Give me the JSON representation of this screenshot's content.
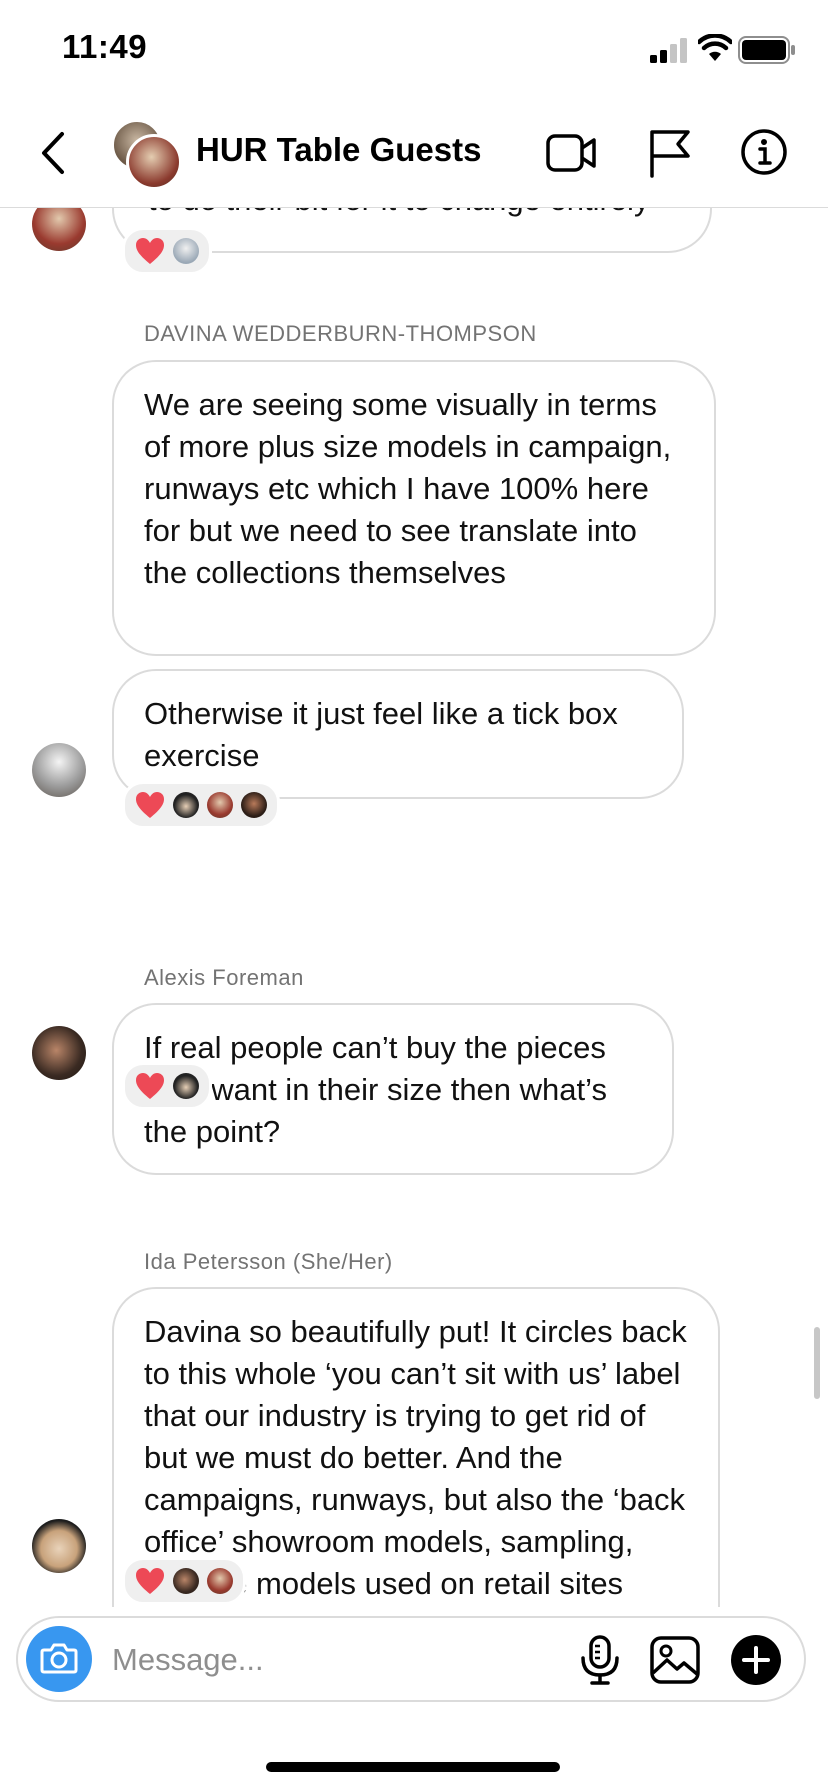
{
  "status_bar": {
    "time": "11:49"
  },
  "header": {
    "title": "HUR Table Guests"
  },
  "messages": [
    {
      "id": "m0",
      "text": "to do their bit for it to change entirely",
      "reactions": {
        "emoji": "heart",
        "count_avatars": 1
      }
    },
    {
      "id": "m1",
      "sender": "DAVINA WEDDERBURN-THOMPSON",
      "text": "We are seeing some visually in terms of more plus size models in campaign, runways etc which I have 100% here for but we need to see translate into the collections themselves"
    },
    {
      "id": "m2",
      "text": "Otherwise it just feel like a tick box exercise",
      "reactions": {
        "emoji": "heart",
        "count_avatars": 3
      }
    },
    {
      "id": "m3",
      "sender": "Alexis Foreman",
      "text": "If real people can’t buy the pieces they want in their size then what’s the point?",
      "reactions": {
        "emoji": "heart",
        "count_avatars": 1
      }
    },
    {
      "id": "m4",
      "sender": "Ida Petersson (She/Her)",
      "text": "Davina so beautifully put! It circles back to this whole ‘you can’t sit with us’ label that our industry is trying to get rid of but we must do better. And the campaigns, runways, but also the ‘back office’ showroom models, sampling, and the models used on retail sites need to get more diverse",
      "reactions": {
        "emoji": "heart",
        "count_avatars": 2
      }
    }
  ],
  "composer": {
    "placeholder": "Message..."
  },
  "colors": {
    "accent": "#3897f0",
    "heart": "#ed4956",
    "bubble_border": "#dbdbdb",
    "sender_gray": "#737373"
  },
  "icons": [
    "back-icon",
    "video-call-icon",
    "flag-icon",
    "info-icon",
    "camera-icon",
    "microphone-icon",
    "gallery-icon",
    "plus-icon",
    "heart-icon"
  ]
}
